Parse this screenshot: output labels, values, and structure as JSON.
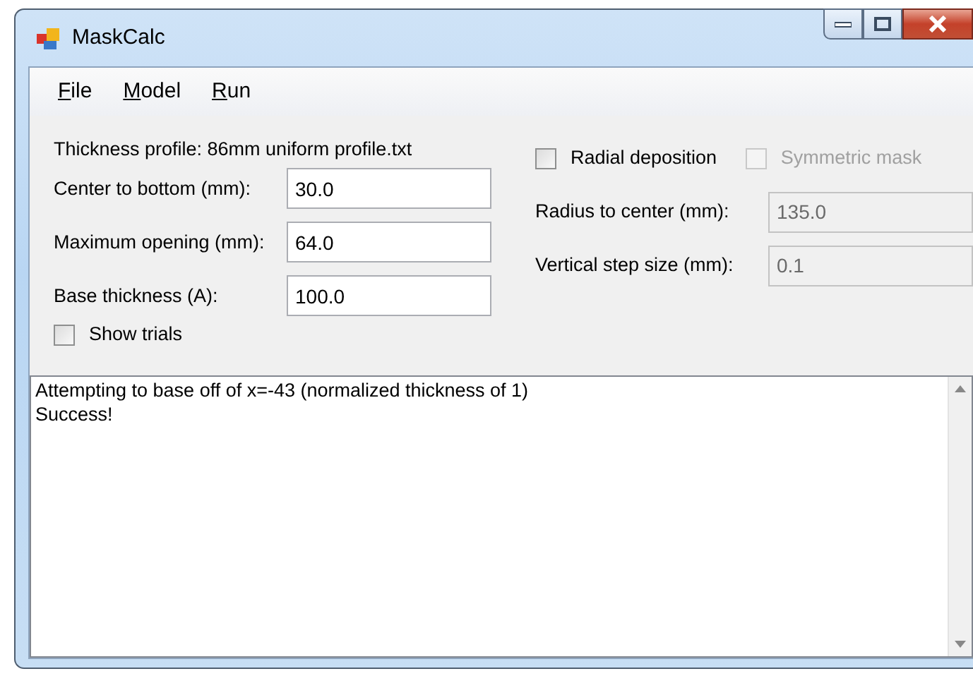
{
  "window": {
    "title": "MaskCalc"
  },
  "menu": [
    {
      "label": "File"
    },
    {
      "label": "Model"
    },
    {
      "label": "Run"
    }
  ],
  "profile": "Thickness profile: 86mm uniform profile.txt",
  "left_fields": [
    {
      "label": "Center to bottom (mm):",
      "value": "30.0",
      "disabled": false
    },
    {
      "label": "Maximum opening (mm):",
      "value": "64.0",
      "disabled": false
    },
    {
      "label": "Base thickness (A):",
      "value": "100.0",
      "disabled": false
    }
  ],
  "show_trials": {
    "label": "Show trials",
    "checked": false,
    "disabled": false
  },
  "right_checkboxes": [
    {
      "label": "Radial deposition",
      "checked": false,
      "disabled": false
    },
    {
      "label": "Symmetric mask",
      "checked": false,
      "disabled": true
    }
  ],
  "right_fields": [
    {
      "label": "Radius to center (mm):",
      "value": "135.0",
      "disabled": true
    },
    {
      "label": "Vertical step size (mm):",
      "value": "0.1",
      "disabled": true
    }
  ],
  "log": [
    "Attempting to base off of x=-43 (normalized thickness of 1)",
    "Success!"
  ]
}
